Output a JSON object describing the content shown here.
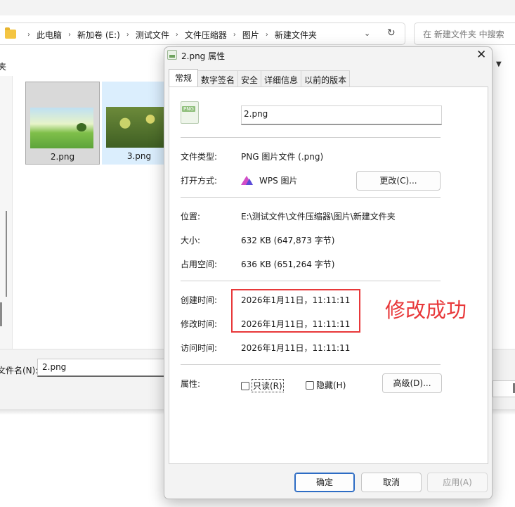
{
  "explorer": {
    "breadcrumbs": [
      "此电脑",
      "新加卷 (E:)",
      "测试文件",
      "文件压缩器",
      "图片",
      "新建文件夹"
    ],
    "search_placeholder": "在 新建文件夹 中搜索",
    "left_clip_text": "夹",
    "files": [
      {
        "name": "2.png",
        "selected": true
      },
      {
        "name": "3.png",
        "selected": false
      }
    ],
    "filename_label": "文件名(N):",
    "filename_value": "2.png"
  },
  "dialog": {
    "title": "2.png 属性",
    "tabs": [
      "常规",
      "数字签名",
      "安全",
      "详细信息",
      "以前的版本"
    ],
    "active_tab": "常规",
    "file_icon_ext": "PNG",
    "filename": "2.png",
    "rows": {
      "type": {
        "label": "文件类型:",
        "value": "PNG 图片文件 (.png)"
      },
      "opens_with": {
        "label": "打开方式:",
        "value": "WPS 图片",
        "button": "更改(C)..."
      },
      "location": {
        "label": "位置:",
        "value": "E:\\测试文件\\文件压缩器\\图片\\新建文件夹"
      },
      "size": {
        "label": "大小:",
        "value": "632 KB (647,873 字节)"
      },
      "size_on_disk": {
        "label": "占用空间:",
        "value": "636 KB (651,264 字节)"
      },
      "created": {
        "label": "创建时间:",
        "value": "2026年1月11日，11:11:11"
      },
      "modified": {
        "label": "修改时间:",
        "value": "2026年1月11日，11:11:11"
      },
      "accessed": {
        "label": "访问时间:",
        "value": "2026年1月11日，11:11:11"
      }
    },
    "attributes": {
      "label": "属性:",
      "readonly": "只读(R)",
      "hidden": "隐藏(H)",
      "advanced": "高级(D)..."
    },
    "buttons": {
      "ok": "确定",
      "cancel": "取消",
      "apply": "应用(A)"
    }
  },
  "annotation": {
    "text": "修改成功",
    "color": "#e8383a"
  }
}
